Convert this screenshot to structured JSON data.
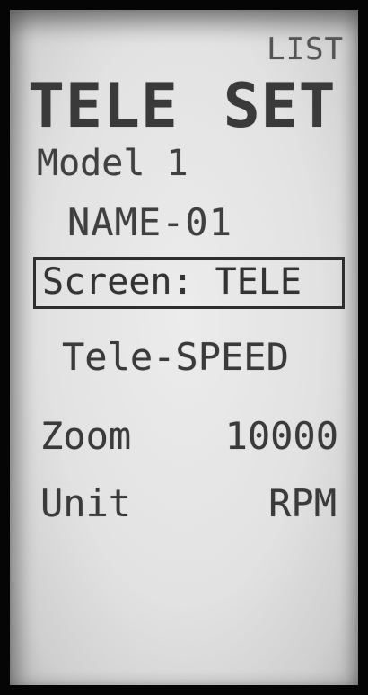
{
  "display": {
    "list_label": "LIST",
    "title": "TELE SET",
    "model": "Model 1",
    "name": "NAME-01",
    "screen_setting": "Screen: TELE",
    "mode": "Tele-SPEED",
    "zoom": {
      "label": "Zoom",
      "value": "10000"
    },
    "unit": {
      "label": "Unit",
      "value": "RPM"
    }
  }
}
